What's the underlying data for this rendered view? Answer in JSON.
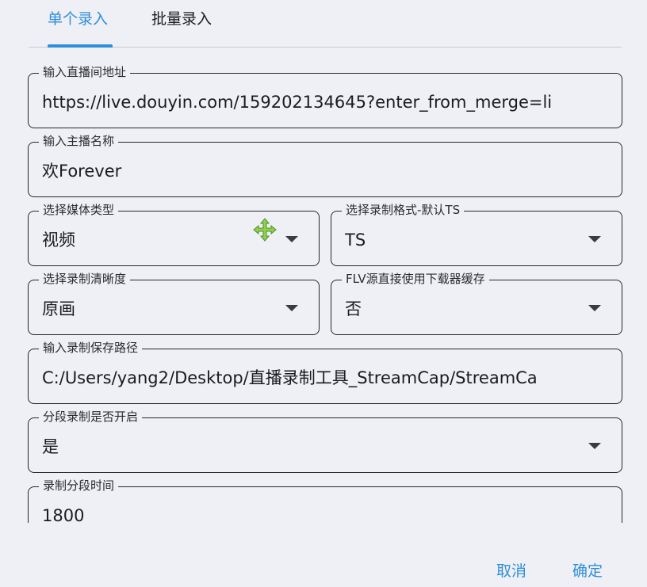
{
  "tabs": [
    {
      "label": "单个录入",
      "active": true
    },
    {
      "label": "批量录入",
      "active": false
    }
  ],
  "fields": {
    "url": {
      "label": "输入直播间地址",
      "value": "https://live.douyin.com/159202134645?enter_from_merge=li"
    },
    "streamer": {
      "label": "输入主播名称",
      "value": "欢Forever"
    },
    "media_type": {
      "label": "选择媒体类型",
      "value": "视频"
    },
    "record_format": {
      "label": "选择录制格式-默认TS",
      "value": "TS"
    },
    "quality": {
      "label": "选择录制清晰度",
      "value": "原画"
    },
    "flv_cache": {
      "label": "FLV源直接使用下载器缓存",
      "value": "否"
    },
    "save_path": {
      "label": "输入录制保存路径",
      "value": "C:/Users/yang2/Desktop/直播录制工具_StreamCap/StreamCa"
    },
    "segment_enabled": {
      "label": "分段录制是否开启",
      "value": "是"
    },
    "segment_time": {
      "label": "录制分段时间",
      "value": "1800"
    }
  },
  "actions": {
    "cancel": "取消",
    "confirm": "确定"
  },
  "icons": {
    "dropdown": "chevron-down-icon",
    "cursor": "move-cursor-icon"
  },
  "colors": {
    "accent": "#2f8fd8",
    "background": "#eff0f5",
    "cursor_green": "#8fd14f"
  }
}
